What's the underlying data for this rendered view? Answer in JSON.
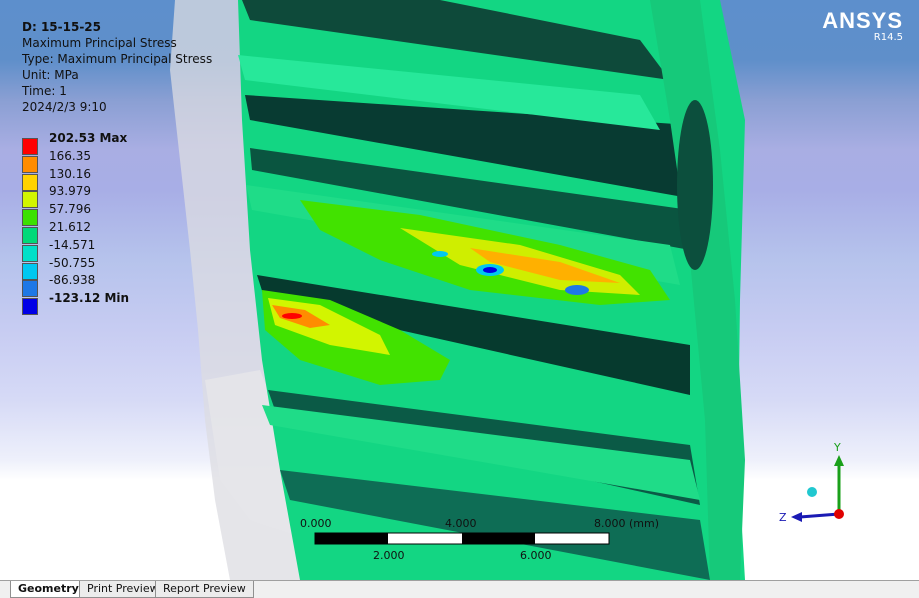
{
  "result": {
    "title": "D: 15-15-25",
    "name": "Maximum Principal Stress",
    "type_line": "Type: Maximum Principal Stress",
    "unit_line": "Unit: MPa",
    "time_line": "Time: 1",
    "date_line": "2024/2/3 9:10"
  },
  "legend": {
    "entries": [
      {
        "label": "202.53 Max",
        "color": "#ff0000",
        "bold": true
      },
      {
        "label": "166.35",
        "color": "#ff8c00",
        "bold": false
      },
      {
        "label": "130.16",
        "color": "#ffd200",
        "bold": false
      },
      {
        "label": "93.979",
        "color": "#d2f500",
        "bold": false
      },
      {
        "label": "57.796",
        "color": "#3ce100",
        "bold": false
      },
      {
        "label": "21.612",
        "color": "#00d97a",
        "bold": false
      },
      {
        "label": "-14.571",
        "color": "#00e0c8",
        "bold": false
      },
      {
        "label": "-50.755",
        "color": "#00c8f0",
        "bold": false
      },
      {
        "label": "-86.938",
        "color": "#1e78e6",
        "bold": false
      },
      {
        "label": "-123.12 Min",
        "color": "#0000e6",
        "bold": true
      }
    ]
  },
  "brand": {
    "logo": "ANSYS",
    "version": "R14.5"
  },
  "scale_bar": {
    "top_labels": [
      "0.000",
      "4.000",
      "8.000 (mm)"
    ],
    "bottom_labels": [
      "2.000",
      "6.000"
    ]
  },
  "triad": {
    "x_label": "Z",
    "y_label": "Y"
  },
  "tabs": [
    {
      "label": "Geometry",
      "active": true
    },
    {
      "label": "Print Preview",
      "active": false
    },
    {
      "label": "Report Preview",
      "active": false
    }
  ]
}
